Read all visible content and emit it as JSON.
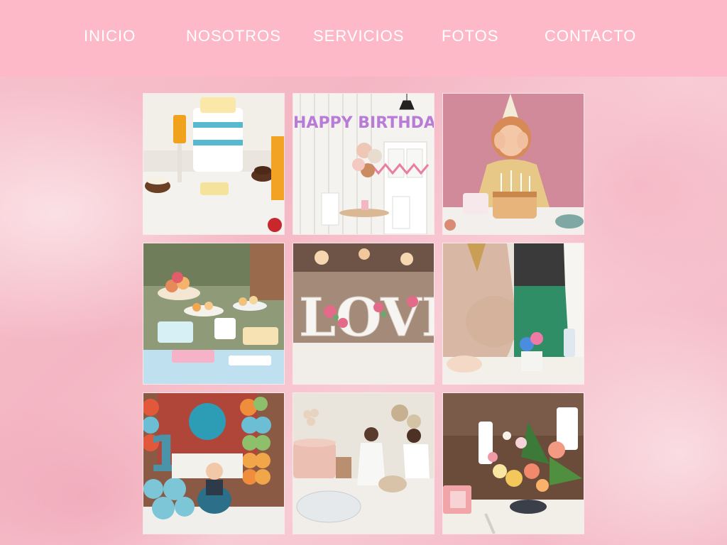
{
  "nav": {
    "items": [
      {
        "label": "INICIO"
      },
      {
        "label": "NOSOTROS"
      },
      {
        "label": "SERVICIOS"
      },
      {
        "label": "FOTOS"
      },
      {
        "label": "CONTACTO"
      }
    ]
  },
  "gallery": {
    "photos": [
      {
        "name": "diaper-cake-table"
      },
      {
        "name": "happy-birthday-decor",
        "banner_text": "HAPPY BIRTHDAY"
      },
      {
        "name": "girl-birthday-cake"
      },
      {
        "name": "dessert-buffet"
      },
      {
        "name": "love-letters-decor",
        "letters_text": "LOVE"
      },
      {
        "name": "baby-shower-pregnant"
      },
      {
        "name": "first-birthday-balloons",
        "number_text": "1"
      },
      {
        "name": "family-party-scene"
      },
      {
        "name": "floral-centerpiece"
      }
    ]
  },
  "colors": {
    "nav_background": "#fdb9c8",
    "nav_text": "#ffffff",
    "page_background": "#f6bdc9"
  }
}
